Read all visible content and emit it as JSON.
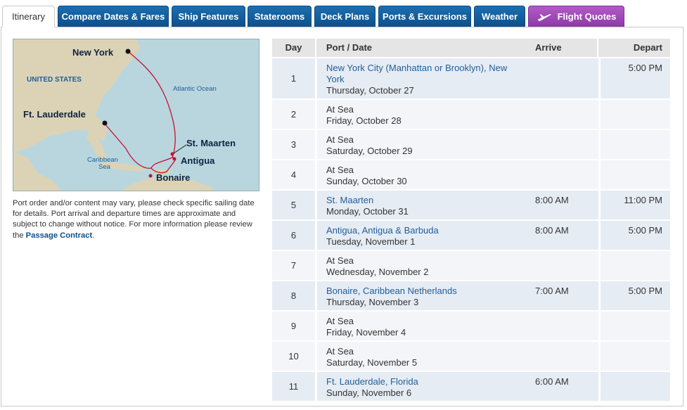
{
  "tabs": [
    {
      "label": "Itinerary",
      "active": true
    },
    {
      "label": "Compare Dates & Fares"
    },
    {
      "label": "Ship Features"
    },
    {
      "label": "Staterooms"
    },
    {
      "label": "Deck Plans"
    },
    {
      "label": "Ports & Excursions"
    },
    {
      "label": "Weather"
    },
    {
      "label": "Flight Quotes",
      "icon": "airplane-icon"
    }
  ],
  "map": {
    "labels": {
      "new_york": "New York",
      "united_states": "UNITED STATES",
      "atlantic": "Atlantic Ocean",
      "ft_lauderdale": "Ft. Lauderdale",
      "st_maarten": "St. Maarten",
      "antigua": "Antigua",
      "caribbean": "Caribbean",
      "sea": "Sea",
      "bonaire": "Bonaire"
    }
  },
  "note": {
    "text": "Port order and/or content may vary, please check specific sailing date for details. Port arrival and departure times are approximate and subject to change without notice. For more information please review the ",
    "link": "Passage Contract",
    "end": "."
  },
  "table": {
    "headers": {
      "day": "Day",
      "port": "Port / Date",
      "arrive": "Arrive",
      "depart": "Depart"
    },
    "rows": [
      {
        "day": "1",
        "port_line1": "New York City (Manhattan or Brooklyn), New",
        "port_line2": "York",
        "date": "Thursday, October 27",
        "arrive": "",
        "depart": "5:00 PM",
        "is_port": true
      },
      {
        "day": "2",
        "port_line1": "At Sea",
        "port_line2": "",
        "date": "Friday, October 28",
        "arrive": "",
        "depart": "",
        "is_port": false
      },
      {
        "day": "3",
        "port_line1": "At Sea",
        "port_line2": "",
        "date": "Saturday, October 29",
        "arrive": "",
        "depart": "",
        "is_port": false
      },
      {
        "day": "4",
        "port_line1": "At Sea",
        "port_line2": "",
        "date": "Sunday, October 30",
        "arrive": "",
        "depart": "",
        "is_port": false
      },
      {
        "day": "5",
        "port_line1": "St. Maarten",
        "port_line2": "",
        "date": "Monday, October 31",
        "arrive": "8:00 AM",
        "depart": "11:00 PM",
        "is_port": true
      },
      {
        "day": "6",
        "port_line1": "Antigua, Antigua & Barbuda",
        "port_line2": "",
        "date": "Tuesday, November 1",
        "arrive": "8:00 AM",
        "depart": "5:00 PM",
        "is_port": true
      },
      {
        "day": "7",
        "port_line1": "At Sea",
        "port_line2": "",
        "date": "Wednesday, November 2",
        "arrive": "",
        "depart": "",
        "is_port": false
      },
      {
        "day": "8",
        "port_line1": "Bonaire, Caribbean Netherlands",
        "port_line2": "",
        "date": "Thursday, November 3",
        "arrive": "7:00 AM",
        "depart": "5:00 PM",
        "is_port": true
      },
      {
        "day": "9",
        "port_line1": "At Sea",
        "port_line2": "",
        "date": "Friday, November 4",
        "arrive": "",
        "depart": "",
        "is_port": false
      },
      {
        "day": "10",
        "port_line1": "At Sea",
        "port_line2": "",
        "date": "Saturday, November 5",
        "arrive": "",
        "depart": "",
        "is_port": false
      },
      {
        "day": "11",
        "port_line1": "Ft. Lauderdale, Florida",
        "port_line2": "",
        "date": "Sunday, November 6",
        "arrive": "6:00 AM",
        "depart": "",
        "is_port": true
      }
    ]
  },
  "colors": {
    "tab_blue": "#0d4f8b",
    "tab_purple": "#8d3aa6",
    "link_blue": "#1f5d9a",
    "row_shaded": "#e8edf4",
    "row_plain": "#f3f5f8",
    "route_red": "#c8102e"
  }
}
